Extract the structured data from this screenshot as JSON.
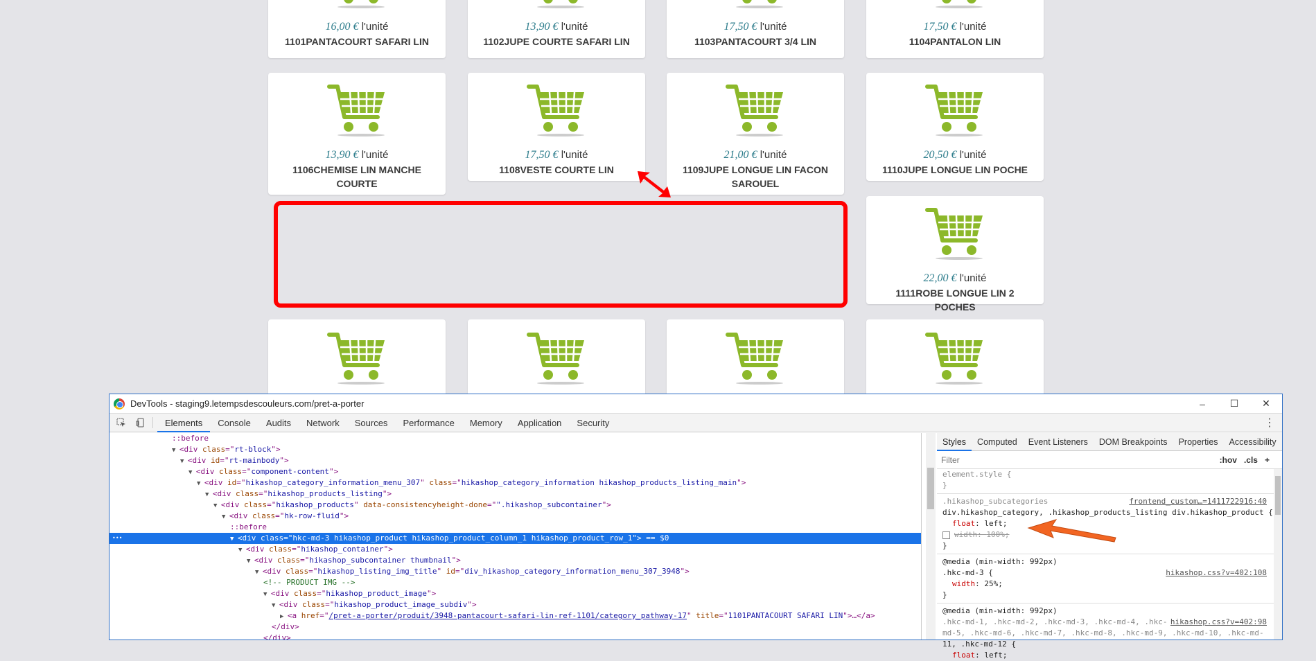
{
  "products": [
    {
      "price": "16,00 €",
      "unit": "l'unité",
      "name": "1101PANTACOURT SAFARI LIN"
    },
    {
      "price": "13,90 €",
      "unit": "l'unité",
      "name": "1102JUPE COURTE SAFARI LIN"
    },
    {
      "price": "17,50 €",
      "unit": "l'unité",
      "name": "1103PANTACOURT 3/4 LIN"
    },
    {
      "price": "17,50 €",
      "unit": "l'unité",
      "name": "1104PANTALON LIN"
    },
    {
      "price": "13,90 €",
      "unit": "l'unité",
      "name": "1106CHEMISE LIN MANCHE COURTE"
    },
    {
      "price": "17,50 €",
      "unit": "l'unité",
      "name": "1108VESTE COURTE LIN"
    },
    {
      "price": "21,00 €",
      "unit": "l'unité",
      "name": "1109JUPE LONGUE LIN FACON SAROUEL"
    },
    {
      "price": "20,50 €",
      "unit": "l'unité",
      "name": "1110JUPE LONGUE LIN POCHE"
    },
    {
      "price": "22,00 €",
      "unit": "l'unité",
      "name": "1111ROBE LONGUE LIN 2 POCHES"
    }
  ],
  "colors": {
    "cart": "#8cb82a",
    "highlight_box": "#ff0000",
    "annotation_arrow": "#f26522",
    "selection": "#1a73e8"
  },
  "devtools": {
    "title": "DevTools - staging9.letempsdescouleurs.com/pret-a-porter",
    "win_buttons": {
      "minimize": "–",
      "maximize": "☐",
      "close": "✕"
    },
    "tabs": [
      "Elements",
      "Console",
      "Audits",
      "Network",
      "Sources",
      "Performance",
      "Memory",
      "Application",
      "Security"
    ],
    "more_icon": "⋮",
    "elements": [
      {
        "indent": 0,
        "arrow": "",
        "html": "::before"
      },
      {
        "indent": 0,
        "arrow": "▼",
        "tag": "div",
        "attrs": [
          [
            "class",
            "rt-block"
          ]
        ]
      },
      {
        "indent": 1,
        "arrow": "▼",
        "tag": "div",
        "attrs": [
          [
            "id",
            "rt-mainbody"
          ]
        ]
      },
      {
        "indent": 2,
        "arrow": "▼",
        "tag": "div",
        "attrs": [
          [
            "class",
            "component-content"
          ]
        ]
      },
      {
        "indent": 3,
        "arrow": "▼",
        "tag": "div",
        "attrs": [
          [
            "id",
            "hikashop_category_information_menu_307"
          ],
          [
            "class",
            "hikashop_category_information hikashop_products_listing_main"
          ]
        ]
      },
      {
        "indent": 4,
        "arrow": "▼",
        "tag": "div",
        "attrs": [
          [
            "class",
            "hikashop_products_listing"
          ]
        ]
      },
      {
        "indent": 5,
        "arrow": "▼",
        "tag": "div",
        "attrs": [
          [
            "class",
            "hikashop_products"
          ],
          [
            "data-consistencyheight-done",
            "\".hikashop_subcontainer"
          ]
        ]
      },
      {
        "indent": 6,
        "arrow": "▼",
        "tag": "div",
        "attrs": [
          [
            "class",
            "hk-row-fluid"
          ]
        ]
      },
      {
        "indent": 7,
        "arrow": "",
        "html": "::before"
      },
      {
        "indent": 7,
        "arrow": "▼",
        "tag": "div",
        "attrs": [
          [
            "class",
            "hkc-md-3 hikashop_product hikashop_product_column_1 hikashop_product_row_1"
          ]
        ],
        "suffix": " == $0",
        "selected": true
      },
      {
        "indent": 8,
        "arrow": "▼",
        "tag": "div",
        "attrs": [
          [
            "class",
            "hikashop_container"
          ]
        ]
      },
      {
        "indent": 9,
        "arrow": "▼",
        "tag": "div",
        "attrs": [
          [
            "class",
            "hikashop_subcontainer thumbnail"
          ]
        ]
      },
      {
        "indent": 10,
        "arrow": "▼",
        "tag": "div",
        "attrs": [
          [
            "class",
            "hikashop_listing_img_title"
          ],
          [
            "id",
            "div_hikashop_category_information_menu_307_3948"
          ]
        ]
      },
      {
        "indent": 11,
        "arrow": "",
        "comment": "<!-- PRODUCT IMG -->"
      },
      {
        "indent": 11,
        "arrow": "▼",
        "tag": "div",
        "attrs": [
          [
            "class",
            "hikashop_product_image"
          ]
        ]
      },
      {
        "indent": 12,
        "arrow": "▼",
        "tag": "div",
        "attrs": [
          [
            "class",
            "hikashop_product_image_subdiv"
          ]
        ]
      },
      {
        "indent": 13,
        "arrow": "▶",
        "tag": "a",
        "attrs": [
          [
            "href",
            "/pret-a-porter/produit/3948-pantacourt-safari-lin-ref-1101/category_pathway-17"
          ],
          [
            "title",
            "1101PANTACOURT SAFARI LIN"
          ]
        ],
        "suffix_tag": "…</a>",
        "href_link": true
      },
      {
        "indent": 12,
        "arrow": "",
        "html": "</div>"
      },
      {
        "indent": 11,
        "arrow": "",
        "html": "</div>"
      }
    ],
    "styles": {
      "tabs": [
        "Styles",
        "Computed",
        "Event Listeners",
        "DOM Breakpoints",
        "Properties",
        "Accessibility"
      ],
      "filter_placeholder": "Filter",
      "filter_tools": [
        ":hov",
        ".cls",
        "+"
      ],
      "rules": [
        {
          "lines": [
            "element.style {",
            "}"
          ]
        },
        {
          "selector_gray": ".hikashop_subcategories",
          "source": "frontend_custom…=1411722916:40",
          "selector": "div.hikashop_category, .hikashop_products_listing div.hikashop_product {",
          "props": [
            {
              "name": "float",
              "value": "left"
            },
            {
              "name": "width",
              "value": "100%",
              "struck": true,
              "checkbox": true
            }
          ],
          "close": "}"
        },
        {
          "media": "@media (min-width: 992px)",
          "selector": ".hkc-md-3 {",
          "source": "hikashop.css?v=402:108",
          "props": [
            {
              "name": "width",
              "value": "25%"
            }
          ],
          "close": "}"
        },
        {
          "media": "@media (min-width: 992px)",
          "selector_multi": [
            ".hkc-md-1, .hkc-md-2, .hkc-md-3, .hkc-md-4, .hkc-",
            "md-5, .hkc-md-6, .hkc-md-7, .hkc-md-8, .hkc-md-9, .hkc-md-10, .hkc-md-",
            "11, .hkc-md-12 {"
          ],
          "source": "hikashop.css?v=402:98",
          "props": [
            {
              "name": "float",
              "value": "left"
            }
          ]
        }
      ]
    }
  }
}
